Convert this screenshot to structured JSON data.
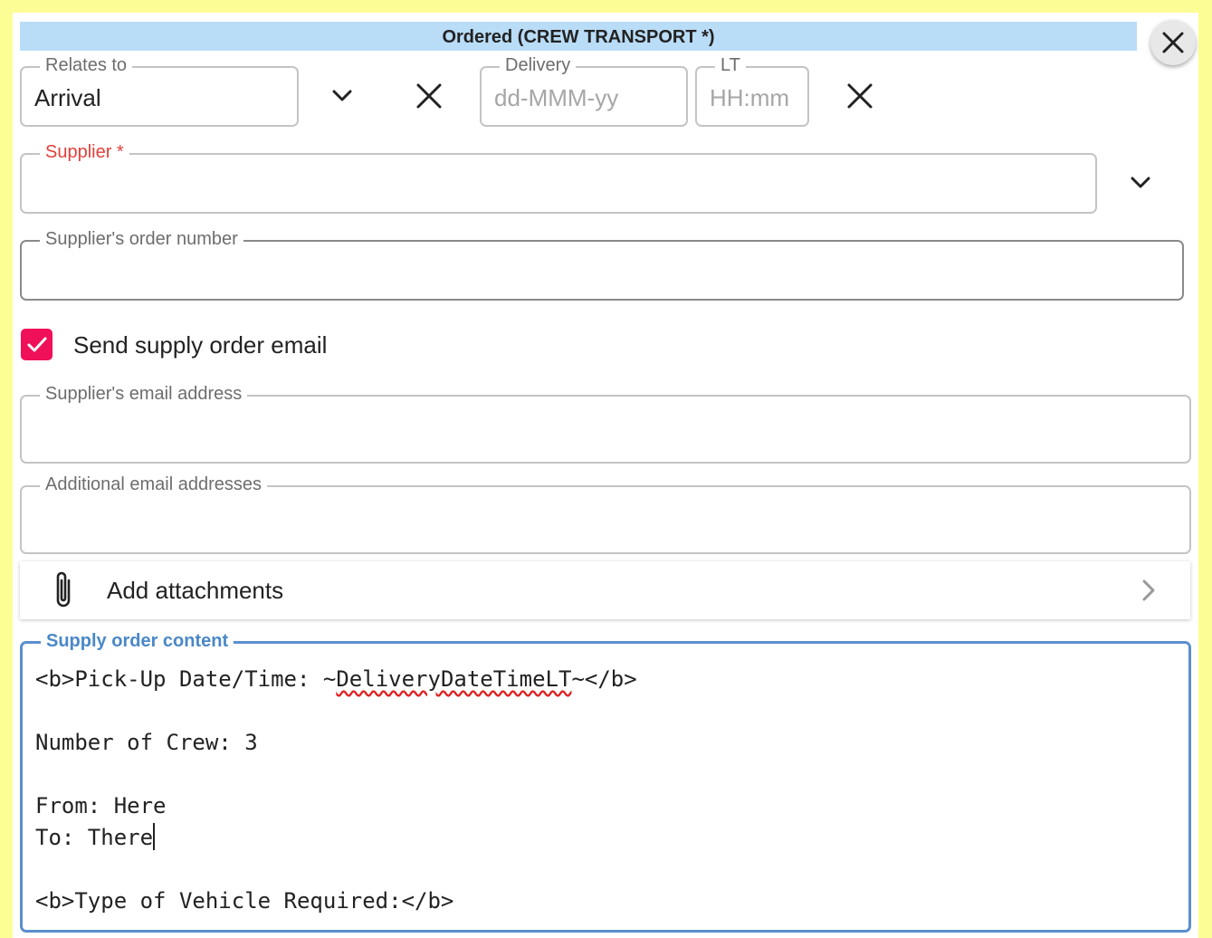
{
  "dialog": {
    "title": "Ordered (CREW TRANSPORT *)"
  },
  "relates_to": {
    "label": "Relates to",
    "value": "Arrival"
  },
  "delivery": {
    "label": "Delivery",
    "placeholder": "dd-MMM-yy"
  },
  "lt": {
    "label": "LT",
    "placeholder": "HH:mm"
  },
  "supplier": {
    "label": "Supplier *",
    "value": ""
  },
  "order_number": {
    "label": "Supplier's order number",
    "value": ""
  },
  "send_email": {
    "label": "Send supply order email",
    "checked": true
  },
  "email_address": {
    "label": "Supplier's email address",
    "value": ""
  },
  "additional_emails": {
    "label": "Additional email addresses",
    "value": ""
  },
  "attachments": {
    "label": "Add attachments"
  },
  "content": {
    "label": "Supply order content",
    "line1_prefix": "<b>Pick-Up Date/Time: ~",
    "line1_token": "DeliveryDateTimeLT",
    "line1_suffix": "~</b>",
    "line2": "",
    "line3": "Number of Crew: 3",
    "line4": "",
    "line5": "From: Here",
    "line6": "To: There",
    "line7": "",
    "line8": "<b>Type of Vehicle Required:</b>"
  },
  "colors": {
    "background": "#fdfd96",
    "title_bar": "#b9dcf7",
    "checkbox": "#f0105a",
    "required": "#e0403b",
    "focus": "#5b8fcf"
  },
  "icons": {
    "close": "close-icon",
    "dropdown": "chevron-down-icon",
    "clear": "clear-icon",
    "checkbox": "check-icon",
    "attachment": "paperclip-icon",
    "expand": "chevron-right-icon"
  }
}
